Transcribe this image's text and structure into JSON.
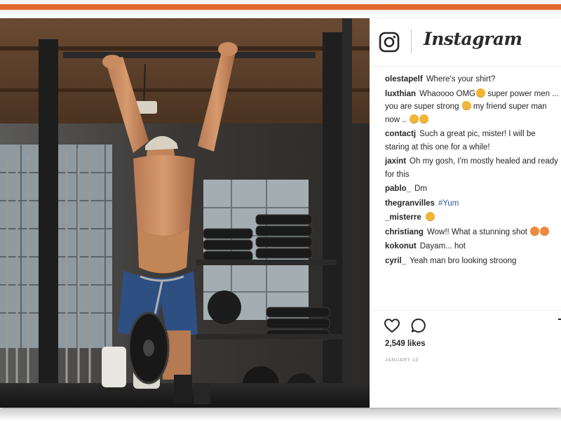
{
  "header": {
    "logo_icon": "instagram-camera-icon",
    "wordmark": "Instagram"
  },
  "comments": [
    {
      "user": "olestapelf",
      "text": "Where's your shirt?"
    },
    {
      "user": "luxthian",
      "text": "Whaoooo OMG",
      "text2": " super power men ... you are super strong ",
      "text3": " my friend super man now .."
    },
    {
      "user": "contactj",
      "text": "Such a great pic, mister! I will be staring at this one for a while!"
    },
    {
      "user": "jaxint",
      "text": "Oh my gosh, I'm mostly healed and ready for this"
    },
    {
      "user": "pablo_",
      "text": "Dm"
    },
    {
      "user": "thegranvilles",
      "text": "#Yum"
    },
    {
      "user": "_misterre",
      "text": ""
    },
    {
      "user": "christiang",
      "text": "Wow!! What a stunning shot "
    },
    {
      "user": "kokonut",
      "text": "Dayam... hot"
    },
    {
      "user": "cyril_",
      "text": "Yeah man bro looking stroong"
    }
  ],
  "actions": {
    "like_icon": "heart-icon",
    "comment_icon": "comment-bubble-icon",
    "save_icon": "bookmark-icon"
  },
  "likes": "2,549 likes",
  "date": "JANUARY 10",
  "colors": {
    "accent_band": "#e1622b",
    "hashtag": "#2b5c9a",
    "text": "#262626"
  }
}
